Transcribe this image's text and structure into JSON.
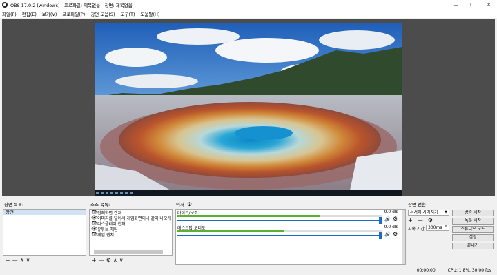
{
  "window": {
    "title": "OBS 17.0.2 (windows) - 프로파일: 제목없음 - 장면: 제목없음",
    "minimize": "—",
    "maximize": "☐",
    "close": "✕"
  },
  "menu": [
    "파일(F)",
    "편집(E)",
    "보기(V)",
    "프로파일(P)",
    "장면 모음(S)",
    "도구(T)",
    "도움말(H)"
  ],
  "docks": {
    "scenes_label": "장면 목록:",
    "sources_label": "소스 목록:",
    "mixer_label": "믹서",
    "transitions_label": "장면 전환"
  },
  "scenes": [
    "장면"
  ],
  "sources": [
    "전체화면 캡처",
    "이미지를 넣어서 게임화면이나 같이 나오게",
    "디스플레이 캡처",
    "유튜브 채팅",
    "게임 캡처"
  ],
  "mixer": [
    {
      "name": "마이크/보조",
      "db": "0.0 dB",
      "level": 0.7,
      "volume": 1.0
    },
    {
      "name": "데스크탑 오디오",
      "db": "0.0 dB",
      "level": 0.52,
      "volume": 1.0
    }
  ],
  "transitions": {
    "selected": "서서히 사라지기",
    "duration_label": "지속 기간",
    "duration_value": "300ms"
  },
  "controls": [
    "방송 시작",
    "녹화 시작",
    "스튜디오 모드",
    "설정",
    "끝내기"
  ],
  "status": {
    "time": "00:00:00",
    "cpu": "CPU: 1.8%, 30.00 fps"
  },
  "toolbar_glyphs": {
    "add": "+",
    "remove": "—",
    "up": "∧",
    "down": "∨",
    "gear": "⚙",
    "eye": "👁",
    "speaker": "🔊"
  }
}
